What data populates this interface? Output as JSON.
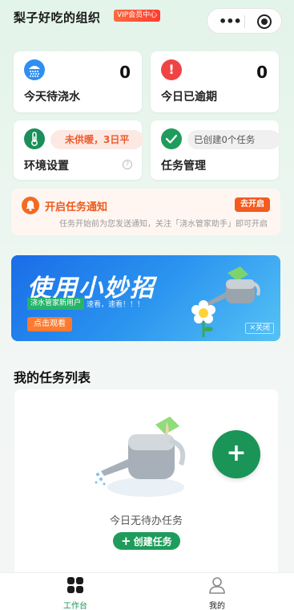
{
  "header": {
    "org_name": "梨子好吃的组织",
    "vip_label": "VIP会员中心"
  },
  "stats": {
    "pending_watering": {
      "label": "今天待浇水",
      "value": "0"
    },
    "overdue_today": {
      "label": "今日已逾期",
      "value": "0"
    }
  },
  "env": {
    "status": "未供暖，3日平",
    "label": "环境设置"
  },
  "tasks": {
    "status": "已创建0个任务",
    "label": "任务管理"
  },
  "notify": {
    "title": "开启任务通知",
    "desc": "任务开始前为您发送通知，关注「浇水管家助手」即可开启",
    "button": "去开启"
  },
  "banner": {
    "headline": "使用小妙招",
    "tag": "浇水管家新用户",
    "speed_text": "速看，速看！！！",
    "watch_button": "点击观看",
    "close_label": "关闭"
  },
  "task_list": {
    "title": "我的任务列表",
    "empty_text": "今日无待办任务",
    "create_button": "创建任务"
  },
  "tabbar": {
    "workbench": "工作台",
    "mine": "我的"
  },
  "colors": {
    "brand_green": "#1a9457",
    "alert_red": "#f04444",
    "accent_orange": "#f45b1e"
  }
}
